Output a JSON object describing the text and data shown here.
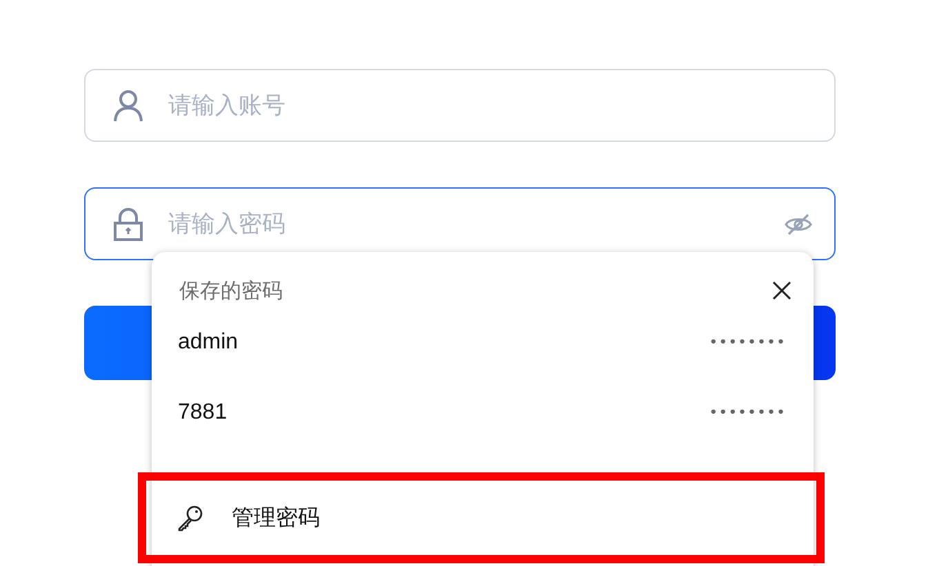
{
  "account_field": {
    "placeholder": "请输入账号"
  },
  "password_field": {
    "placeholder": "请输入密码",
    "focused": true
  },
  "saved_passwords_popup": {
    "title": "保存的密码",
    "entries": [
      {
        "username": "admin",
        "password_mask": "••••••••"
      },
      {
        "username": "7881",
        "password_mask": "••••••••"
      }
    ],
    "manage_label": "管理密码",
    "manage_highlighted": true
  }
}
